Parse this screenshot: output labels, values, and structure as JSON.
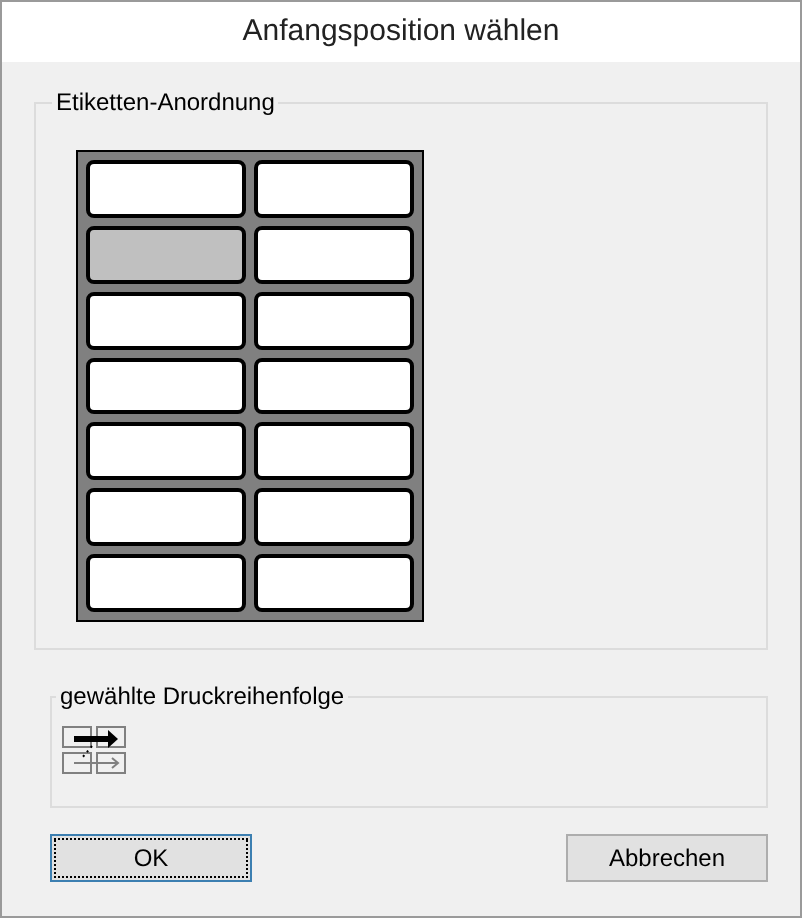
{
  "window": {
    "title": "Anfangsposition wählen"
  },
  "layout_group": {
    "title": "Etiketten-Anordnung",
    "labels": [
      {
        "selected": false
      },
      {
        "selected": false
      },
      {
        "selected": true
      },
      {
        "selected": false
      },
      {
        "selected": false
      },
      {
        "selected": false
      },
      {
        "selected": false
      },
      {
        "selected": false
      },
      {
        "selected": false
      },
      {
        "selected": false
      },
      {
        "selected": false
      },
      {
        "selected": false
      },
      {
        "selected": false
      },
      {
        "selected": false
      }
    ]
  },
  "order_group": {
    "title": "gewählte Druckreihenfolge"
  },
  "buttons": [
    {
      "label": "OK",
      "default": true
    },
    {
      "label": "Abbrechen",
      "default": false
    }
  ]
}
